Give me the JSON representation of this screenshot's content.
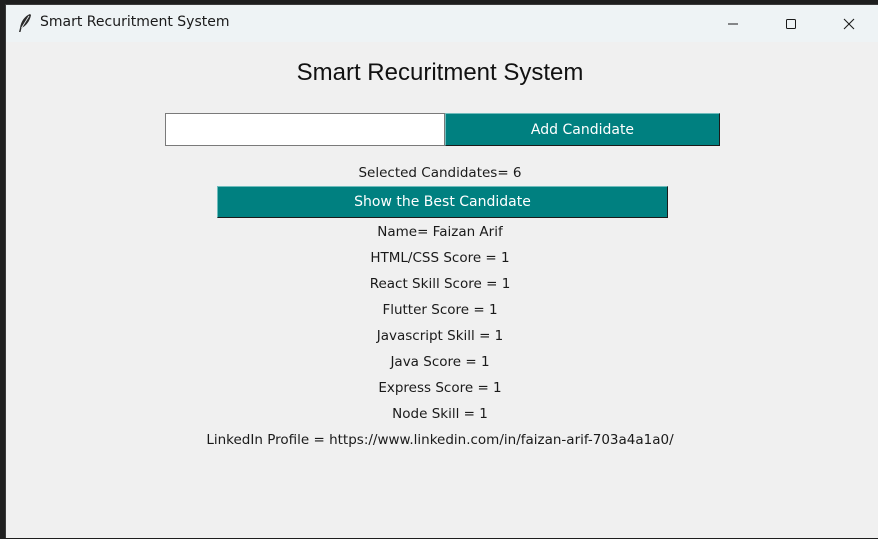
{
  "window": {
    "title": "Smart Recuritment System",
    "icon": "feather-icon",
    "controls": [
      "minimize-icon",
      "maximize-icon",
      "close-icon"
    ]
  },
  "app": {
    "heading": "Smart Recuritment System",
    "candidate_input": {
      "value": "",
      "placeholder": ""
    },
    "add_button_label": "Add Candidate",
    "selected_candidates": "Selected Candidates= 6",
    "best_button_label": "Show the Best Candidate",
    "result": {
      "name": "Name= Faizan Arif",
      "html_css": "HTML/CSS Score = 1",
      "react": "React Skill Score = 1",
      "flutter": "Flutter Score = 1",
      "javascript": "Javascript Skill = 1",
      "java": "Java Score = 1",
      "express": "Express Score = 1",
      "node": "Node Skill = 1",
      "linkedin": "LinkedIn Profile = https://www.linkedin.com/in/faizan-arif-703a4a1a0/"
    }
  },
  "colors": {
    "button_bg": "#008080",
    "button_text": "#ffffff",
    "window_bg": "#f0f0f0",
    "titlebar_bg": "#eef3f5"
  }
}
